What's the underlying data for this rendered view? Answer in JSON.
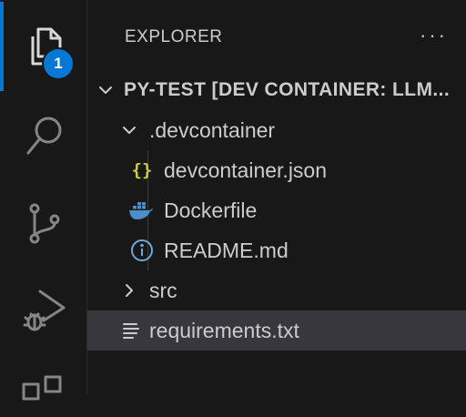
{
  "activity_bar": {
    "explorer_badge": "1",
    "icons": [
      "files-icon",
      "search-icon",
      "source-control-icon",
      "run-debug-icon",
      "extensions-icon"
    ]
  },
  "explorer": {
    "title": "EXPLORER",
    "more_actions": "···",
    "root_folder": "PY-TEST [DEV CONTAINER: LLM...",
    "tree": [
      {
        "label": ".devcontainer",
        "type": "folder",
        "expanded": true
      },
      {
        "label": "devcontainer.json",
        "type": "json-file"
      },
      {
        "label": "Dockerfile",
        "type": "docker-file"
      },
      {
        "label": "README.md",
        "type": "info-file"
      },
      {
        "label": "src",
        "type": "folder",
        "expanded": false
      },
      {
        "label": "requirements.txt",
        "type": "text-file",
        "selected": true
      }
    ]
  },
  "colors": {
    "background": "#181818",
    "accent": "#0078d4",
    "selection": "#37373d",
    "json_icon": "#cbcb41",
    "docker_icon": "#4b8fc9",
    "info_icon": "#6ea8d8"
  }
}
